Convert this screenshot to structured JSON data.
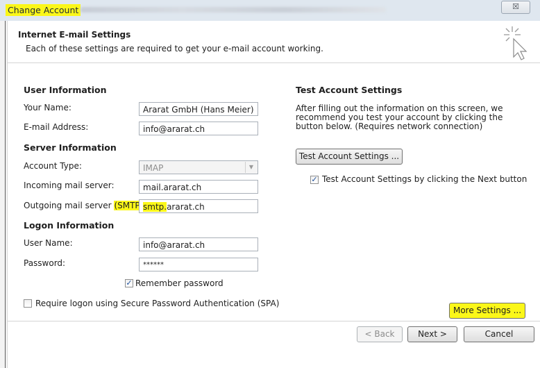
{
  "window": {
    "title": "Change Account",
    "close_glyph": "☒"
  },
  "header": {
    "title": "Internet E-mail Settings",
    "subtitle": "Each of these settings are required to get your e-mail account working."
  },
  "user_info": {
    "heading": "User Information",
    "your_name_label": "Your Name:",
    "your_name_value": "Ararat GmbH (Hans Meier)",
    "email_label": "E-mail Address:",
    "email_value": "info@ararat.ch"
  },
  "server_info": {
    "heading": "Server Information",
    "account_type_label": "Account Type:",
    "account_type_value": "IMAP",
    "incoming_label": "Incoming mail server:",
    "incoming_value": "mail.ararat.ch",
    "outgoing_label_pre": "Outgoing mail server",
    "outgoing_label_hl": "(SMTP):",
    "outgoing_value_hl": "smtp.",
    "outgoing_value_rest": "ararat.ch"
  },
  "logon_info": {
    "heading": "Logon Information",
    "username_label": "User Name:",
    "username_value": "info@ararat.ch",
    "password_label": "Password:",
    "password_value": "******",
    "remember_label": "Remember password",
    "remember_checked": true,
    "spa_label": "Require logon using Secure Password Authentication (SPA)",
    "spa_checked": false
  },
  "test_settings": {
    "heading": "Test Account Settings",
    "description": "After filling out the information on this screen, we recommend you test your account by clicking the button below. (Requires network connection)",
    "button_label": "Test Account Settings ...",
    "next_checkbox_label": "Test Account Settings by clicking the Next button",
    "next_checkbox_checked": true
  },
  "more_settings_label": "More Settings ...",
  "footer": {
    "back_label": "< Back",
    "next_label": "Next >",
    "cancel_label": "Cancel"
  },
  "colors": {
    "highlight": "#fbf719",
    "titlebar": "#dfe7ef"
  },
  "icons": {
    "check": "✓",
    "dropdown": "▼",
    "wizard": "wizard-cursor-icon"
  }
}
